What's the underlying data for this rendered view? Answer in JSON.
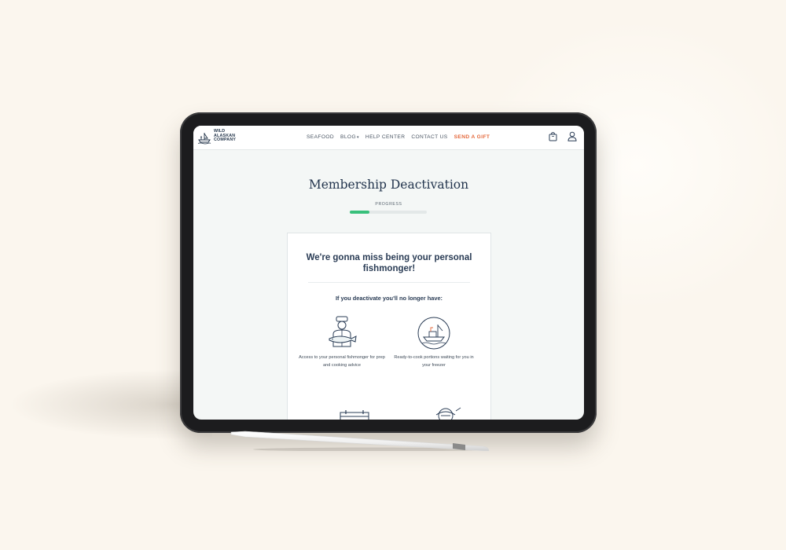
{
  "brand": {
    "logo_lines": [
      "WILD",
      "ALASKAN",
      "COMPANY"
    ]
  },
  "nav": {
    "links": [
      "SEAFOOD",
      "BLOG",
      "HELP CENTER",
      "CONTACT US",
      "SEND A GIFT"
    ],
    "gift_color": "#e4683b"
  },
  "page": {
    "title": "Membership Deactivation",
    "progress_label": "PROGRESS",
    "progress_fraction": 0.25,
    "progress_color": "#38c07b"
  },
  "card": {
    "heading": "We're gonna miss being your personal fishmonger!",
    "subheading": "If you deactivate you'll no longer have:",
    "benefits": [
      {
        "icon": "fishmonger-icon",
        "text": "Access to your personal fishmonger for prep and cooking advice"
      },
      {
        "icon": "fishing-boat-icon",
        "text": "Ready-to-cook portions waiting for you in your freezer"
      },
      {
        "icon": "calendar-icon",
        "text": ""
      },
      {
        "icon": "fisherman-icon",
        "text": ""
      }
    ]
  }
}
